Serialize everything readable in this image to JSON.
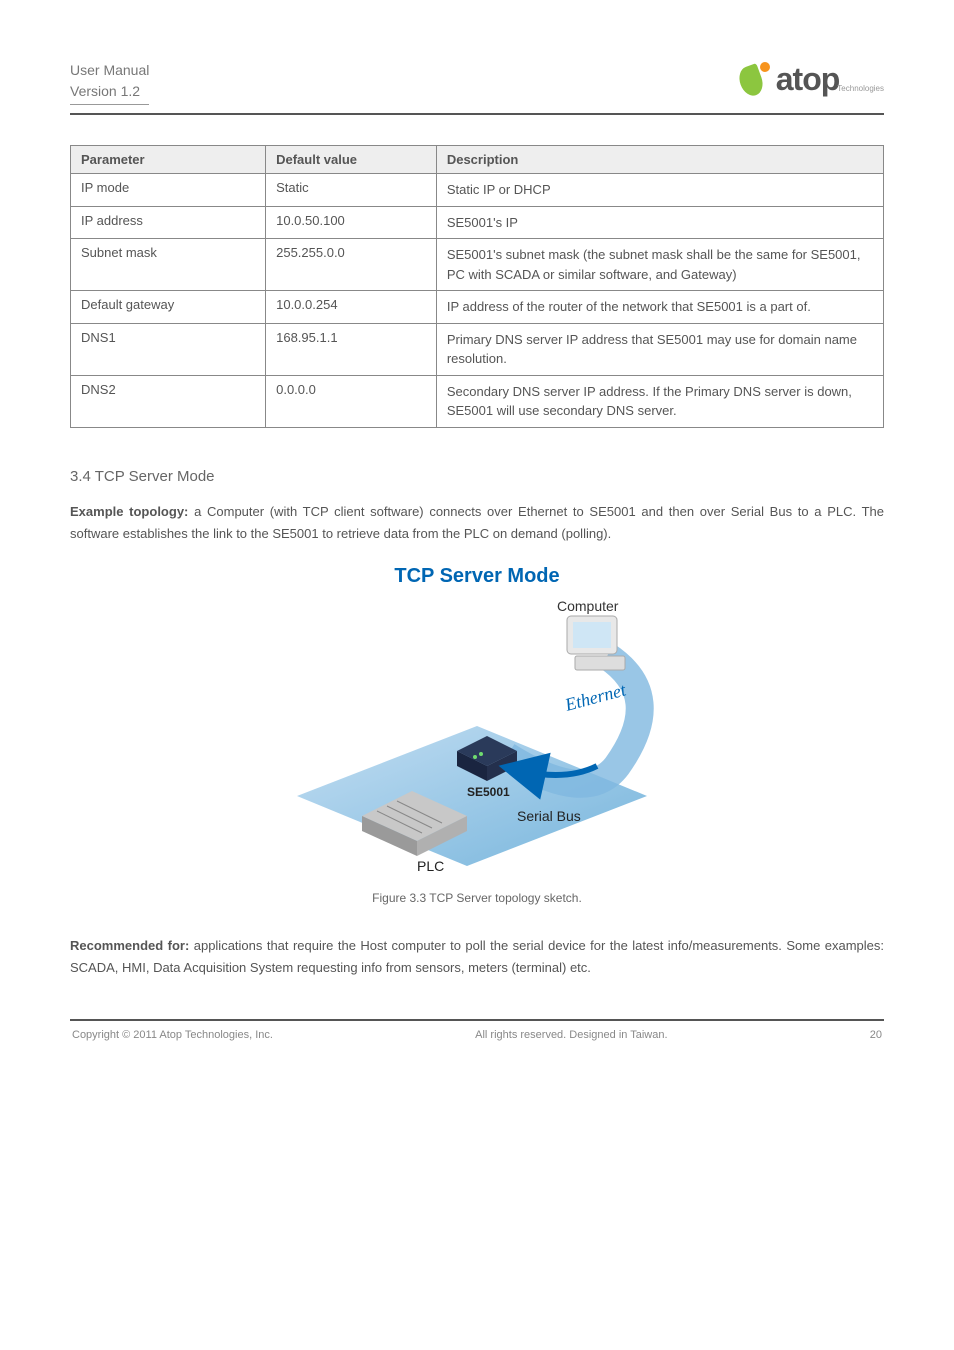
{
  "header": {
    "doc_type": "User Manual",
    "version": "Version 1.2"
  },
  "logo": {
    "text": "atop",
    "sub": "Technologies"
  },
  "table": {
    "header": {
      "c1": "Parameter",
      "c2": "Default value",
      "c3": "Description"
    },
    "rows": [
      {
        "c1": "IP mode",
        "c2": "Static",
        "c3": "Static IP or DHCP"
      },
      {
        "c1": "IP address",
        "c2": "10.0.50.100",
        "c3": "SE5001's IP"
      },
      {
        "c1": "Subnet mask",
        "c2": "255.255.0.0",
        "c3": "SE5001's subnet mask (the subnet mask shall be the same for SE5001, PC with SCADA or similar software, and Gateway)"
      },
      {
        "c1": "Default gateway",
        "c2": "10.0.0.254",
        "c3": "IP address of the router of the network that SE5001 is a part of."
      },
      {
        "c1": "DNS1",
        "c2": "168.95.1.1",
        "c3": "Primary DNS server IP address that SE5001 may use for domain name resolution."
      },
      {
        "c1": "DNS2",
        "c2": "0.0.0.0",
        "c3": "Secondary DNS server IP address. If the Primary DNS server is down, SE5001 will use secondary DNS server."
      }
    ]
  },
  "section1": {
    "title": "3.4 TCP Server Mode"
  },
  "para1": {
    "lead": "Example topology:",
    "text": " a Computer (with TCP client software) connects over Ethernet to SE5001 and then over Serial Bus to a PLC. The software establishes the link to the SE5001 to retrieve data from the PLC on demand (polling)."
  },
  "diagram": {
    "title": "TCP Server Mode",
    "labels": {
      "computer": "Computer",
      "ethernet": "Ethernet",
      "device": "SE5001",
      "serial": "Serial Bus",
      "plc": "PLC"
    }
  },
  "caption": "Figure 3.3 TCP Server topology sketch.",
  "para2": {
    "lead": "Recommended for:",
    "text": " applications that require the Host computer to poll the serial device for the latest info/measurements. Some examples: SCADA, HMI, Data Acquisition System requesting info from sensors, meters (terminal) etc."
  },
  "footer": {
    "left": "Copyright © 2011 Atop Technologies, Inc.",
    "center": "All rights reserved. Designed in Taiwan.",
    "right": "20"
  }
}
